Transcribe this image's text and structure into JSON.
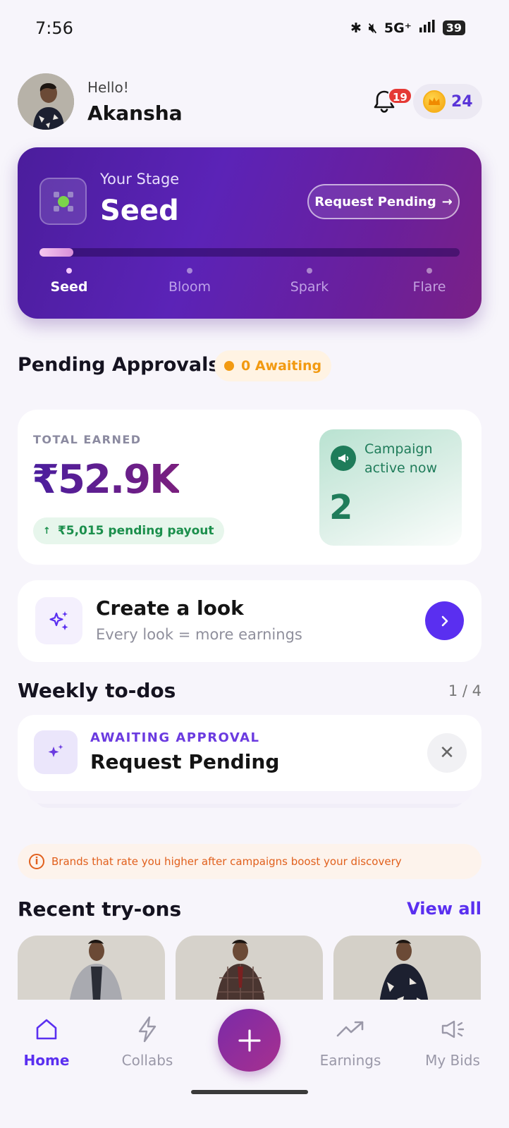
{
  "status_bar": {
    "time": "7:56",
    "network": "5G⁺",
    "battery": "39"
  },
  "header": {
    "greeting": "Hello!",
    "user_name": "Akansha",
    "notification_count": "19",
    "coin_count": "24"
  },
  "stage_card": {
    "label": "Your Stage",
    "current_stage": "Seed",
    "request_button": "Request Pending",
    "progress_fraction": 0.08,
    "steps": [
      "Seed",
      "Bloom",
      "Spark",
      "Flare"
    ]
  },
  "pending_approvals": {
    "title": "Pending Approvals",
    "badge": "0 Awaiting"
  },
  "earnings": {
    "label": "TOTAL EARNED",
    "value": "₹52.9K",
    "pending_payout": "₹5,015 pending payout",
    "campaign_label": "Campaign active now",
    "campaign_count": "2"
  },
  "create_look": {
    "title": "Create a look",
    "subtitle": "Every look = more earnings"
  },
  "weekly_todos": {
    "title": "Weekly to-dos",
    "progress": "1 / 4",
    "item_tag": "AWAITING APPROVAL",
    "item_title": "Request Pending"
  },
  "info_banner": {
    "text": "Brands that rate you higher after campaigns boost your discovery"
  },
  "recent_tryons": {
    "title": "Recent try-ons",
    "view_all": "View all"
  },
  "bottom_nav": {
    "items": [
      {
        "label": "Home",
        "icon": "home-icon"
      },
      {
        "label": "Collabs",
        "icon": "bolt-icon"
      },
      {
        "label": "Earnings",
        "icon": "trending-up-icon"
      },
      {
        "label": "My Bids",
        "icon": "megaphone-icon"
      }
    ]
  },
  "colors": {
    "accent": "#5a2ff0",
    "stage_gradient_start": "#4b1d9c",
    "stage_gradient_end": "#7a2186",
    "success": "#1f7c5a",
    "warning": "#f29a11",
    "alert": "#e1601d"
  }
}
